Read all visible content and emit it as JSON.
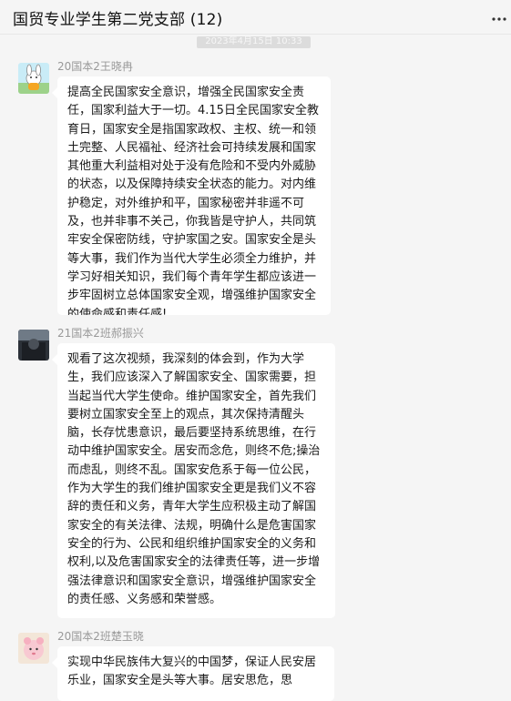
{
  "header": {
    "title": "国贸专业学生第二党支部 (12)",
    "more_icon": "more-horizontal-icon",
    "minimize_icon": "minimize-icon",
    "maximize_icon": "maximize-icon",
    "close_icon": "close-icon"
  },
  "time_divider": "2023年4月15日 10:33",
  "messages": [
    {
      "sender": "20国本2王晓冉",
      "avatar": "cartoon-character-avatar",
      "text": "提高全民国家安全意识，增强全民国家安全责任，国家利益大于一切。4.15日全民国家安全教育日，国家安全是指国家政权、主权、统一和领土完整、人民福祉、经济社会可持续发展和国家其他重大利益相对处于没有危险和不受内外威胁的状态，以及保障持续安全状态的能力。对内维护稳定，对外维护和平，国家秘密并非遥不可及，也并非事不关己，你我皆是守护人，共同筑牢安全保密防线，守护家国之安。国家安全是头等大事，我们作为当代大学生必须全力维护，并学习好相关知识，我们每个青年学生都应该进一步牢固树立总体国家安全观，增强维护国家安全的使命感和责任感!"
    },
    {
      "sender": "21国本2班郝振兴",
      "avatar": "dark-photo-avatar",
      "text": "观看了这次视频，我深刻的体会到，作为大学生，我们应该深入了解国家安全、国家需要，担当起当代大学生使命。维护国家安全，首先我们要树立国家安全至上的观点，其次保持清醒头脑，长存忧患意识，最后要坚持系统思维，在行动中维护国家安全。居安而念危，则终不危;操治而虑乱，则终不乱。国家安危系于每一位公民，作为大学生的我们维护国家安全更是我们义不容辞的责任和义务，青年大学生应积极主动了解国家安全的有关法律、法规，明确什么是危害国家安全的行为、公民和组织维护国家安全的义务和权利,以及危害国家安全的法律责任等，进一步增强法律意识和国家安全意识，增强维护国家安全的责任感、义务感和荣誉感。"
    },
    {
      "sender": "20国本2班楚玉晓",
      "avatar": "pink-cartoon-avatar",
      "text": "实现中华民族伟大复兴的中国梦，保证人民安居乐业，国家安全是头等大事。居安思危，思"
    }
  ]
}
